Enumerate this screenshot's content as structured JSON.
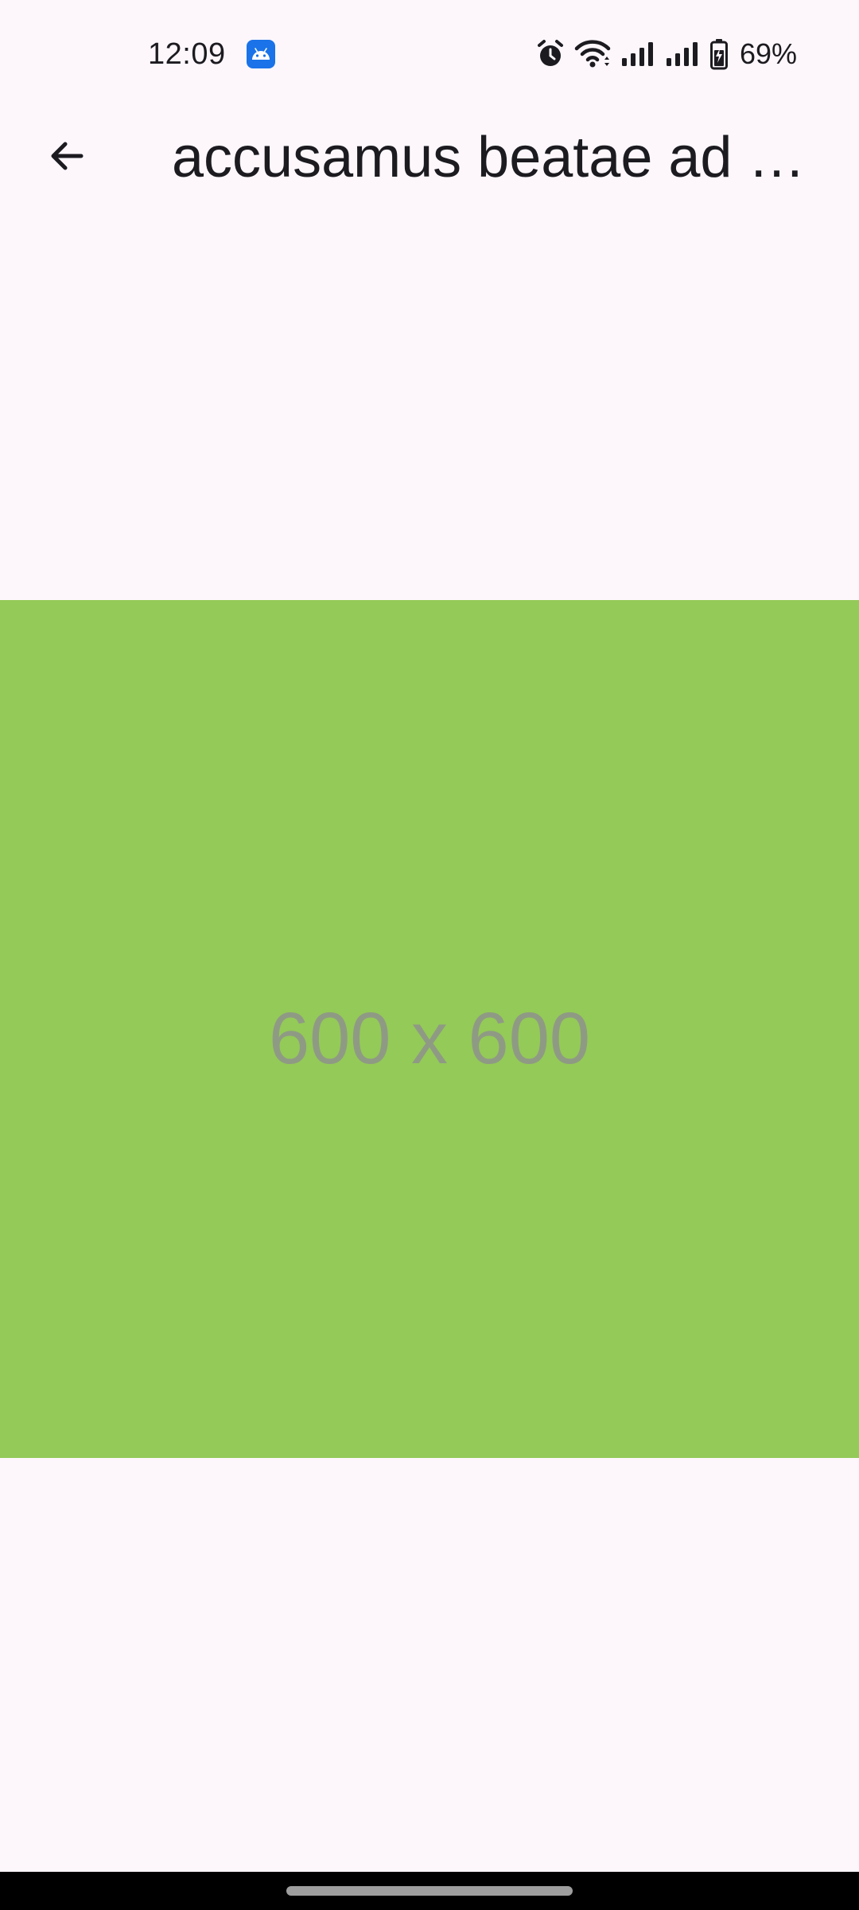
{
  "status_bar": {
    "time": "12:09",
    "battery": "69%",
    "icons": [
      "android-app-icon",
      "alarm-icon",
      "wifi-icon",
      "signal-icon",
      "signal-icon",
      "battery-charging-icon"
    ]
  },
  "app_bar": {
    "back_icon": "arrow-back-icon",
    "title": "accusamus beatae ad …"
  },
  "image": {
    "label": "600 x 600",
    "background": "#94ca58"
  },
  "nav_bar": {
    "home_indicator": "home-indicator"
  }
}
